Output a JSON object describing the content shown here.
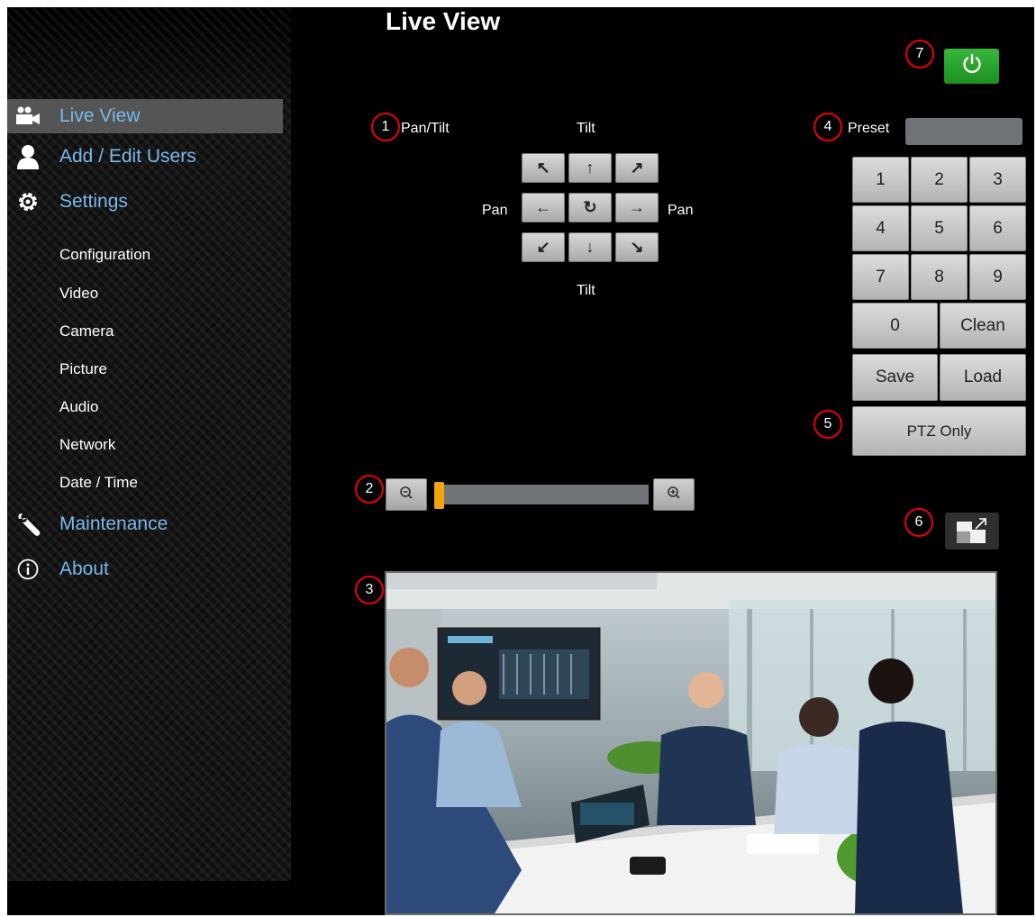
{
  "header": {
    "title": "Live View"
  },
  "sidebar": {
    "items": [
      {
        "label": "Live View",
        "icon": "camera-icon",
        "active": true
      },
      {
        "label": "Add / Edit Users",
        "icon": "user-icon"
      },
      {
        "label": "Settings",
        "icon": "gear-icon"
      },
      {
        "label": "Maintenance",
        "icon": "wrench-icon"
      },
      {
        "label": "About",
        "icon": "info-icon"
      }
    ],
    "settings_sub": [
      "Configuration",
      "Video",
      "Camera",
      "Picture",
      "Audio",
      "Network",
      "Date / Time"
    ]
  },
  "callouts": [
    "1",
    "2",
    "3",
    "4",
    "5",
    "6",
    "7"
  ],
  "pantilt": {
    "title": "Pan/Tilt",
    "tilt_top": "Tilt",
    "tilt_bottom": "Tilt",
    "pan_left": "Pan",
    "pan_right": "Pan",
    "buttons": [
      "↖",
      "↑",
      "↗",
      "←",
      "↻",
      "→",
      "↙",
      "↓",
      "↘"
    ]
  },
  "preset": {
    "label": "Preset",
    "value": "",
    "keys": [
      "1",
      "2",
      "3",
      "4",
      "5",
      "6",
      "7",
      "8",
      "9"
    ],
    "zero": "0",
    "clean": "Clean",
    "save": "Save",
    "load": "Load"
  },
  "ptz_only": "PTZ Only",
  "zoom": {
    "level": 0.0,
    "out_icon": "zoom-out-icon",
    "in_icon": "zoom-in-icon"
  },
  "colors": {
    "accent_link": "#7ab8ea",
    "callout_border": "#e00000",
    "power": "#2aa52e",
    "zoom_thumb": "#f4a40c"
  },
  "video": {
    "description_icon": "live-camera-feed"
  }
}
